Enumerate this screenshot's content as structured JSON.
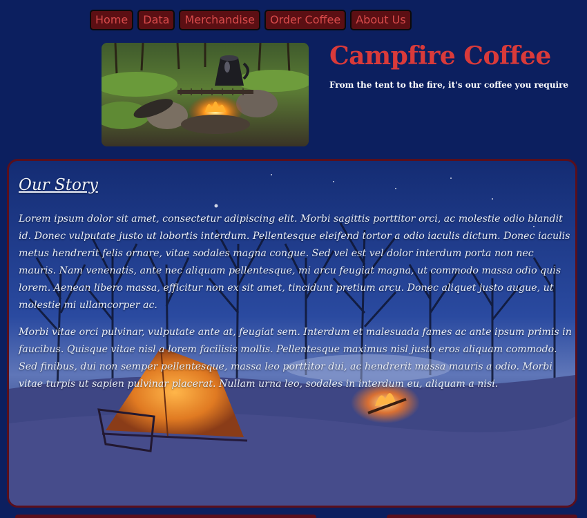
{
  "nav": {
    "items": [
      {
        "label": "Home"
      },
      {
        "label": "Data"
      },
      {
        "label": "Merchandise"
      },
      {
        "label": "Order Coffee"
      },
      {
        "label": "About Us"
      }
    ]
  },
  "header": {
    "title": "Campfire Coffee",
    "tagline": "From the tent to the fire, it's our coffee you require",
    "image_icon": "campfire-coffee-pot-image"
  },
  "story": {
    "heading": "Our Story",
    "paragraphs": [
      "Lorem ipsum dolor sit amet, consectetur adipiscing elit. Morbi sagittis porttitor orci, ac molestie odio blandit id. Donec vulputate justo ut lobortis interdum. Pellentesque eleifend tortor a odio iaculis dictum. Donec iaculis metus hendrerit felis ornare, vitae sodales magna congue. Sed vel est vel dolor interdum porta non nec mauris. Nam venenatis, ante nec aliquam pellentesque, mi arcu feugiat magna, ut commodo massa odio quis lorem. Aenean libero massa, efficitur non ex sit amet, tincidunt pretium arcu. Donec aliquet justo augue, ut molestie mi ullamcorper ac.",
      "Morbi vitae orci pulvinar, vulputate ante at, feugiat sem. Interdum et malesuada fames ac ante ipsum primis in faucibus. Quisque vitae nisl a lorem facilisis mollis. Pellentesque maximus nisl justo eros aliquam commodo. Sed finibus, dui non semper pellentesque, massa leo porttitor dui, ac hendrerit massa mauris a odio. Morbi vitae turpis ut sapien pulvinar placerat. Nullam urna leo, sodales in interdum eu, aliquam a nisi."
    ],
    "background_icon": "night-campsite-tent-image"
  },
  "colors": {
    "page_bg": "#0c1f5f",
    "nav_bg": "#5b0f13",
    "nav_text": "#d94b4b",
    "title": "#d93a3a",
    "panel_border": "#5a0f1c"
  }
}
